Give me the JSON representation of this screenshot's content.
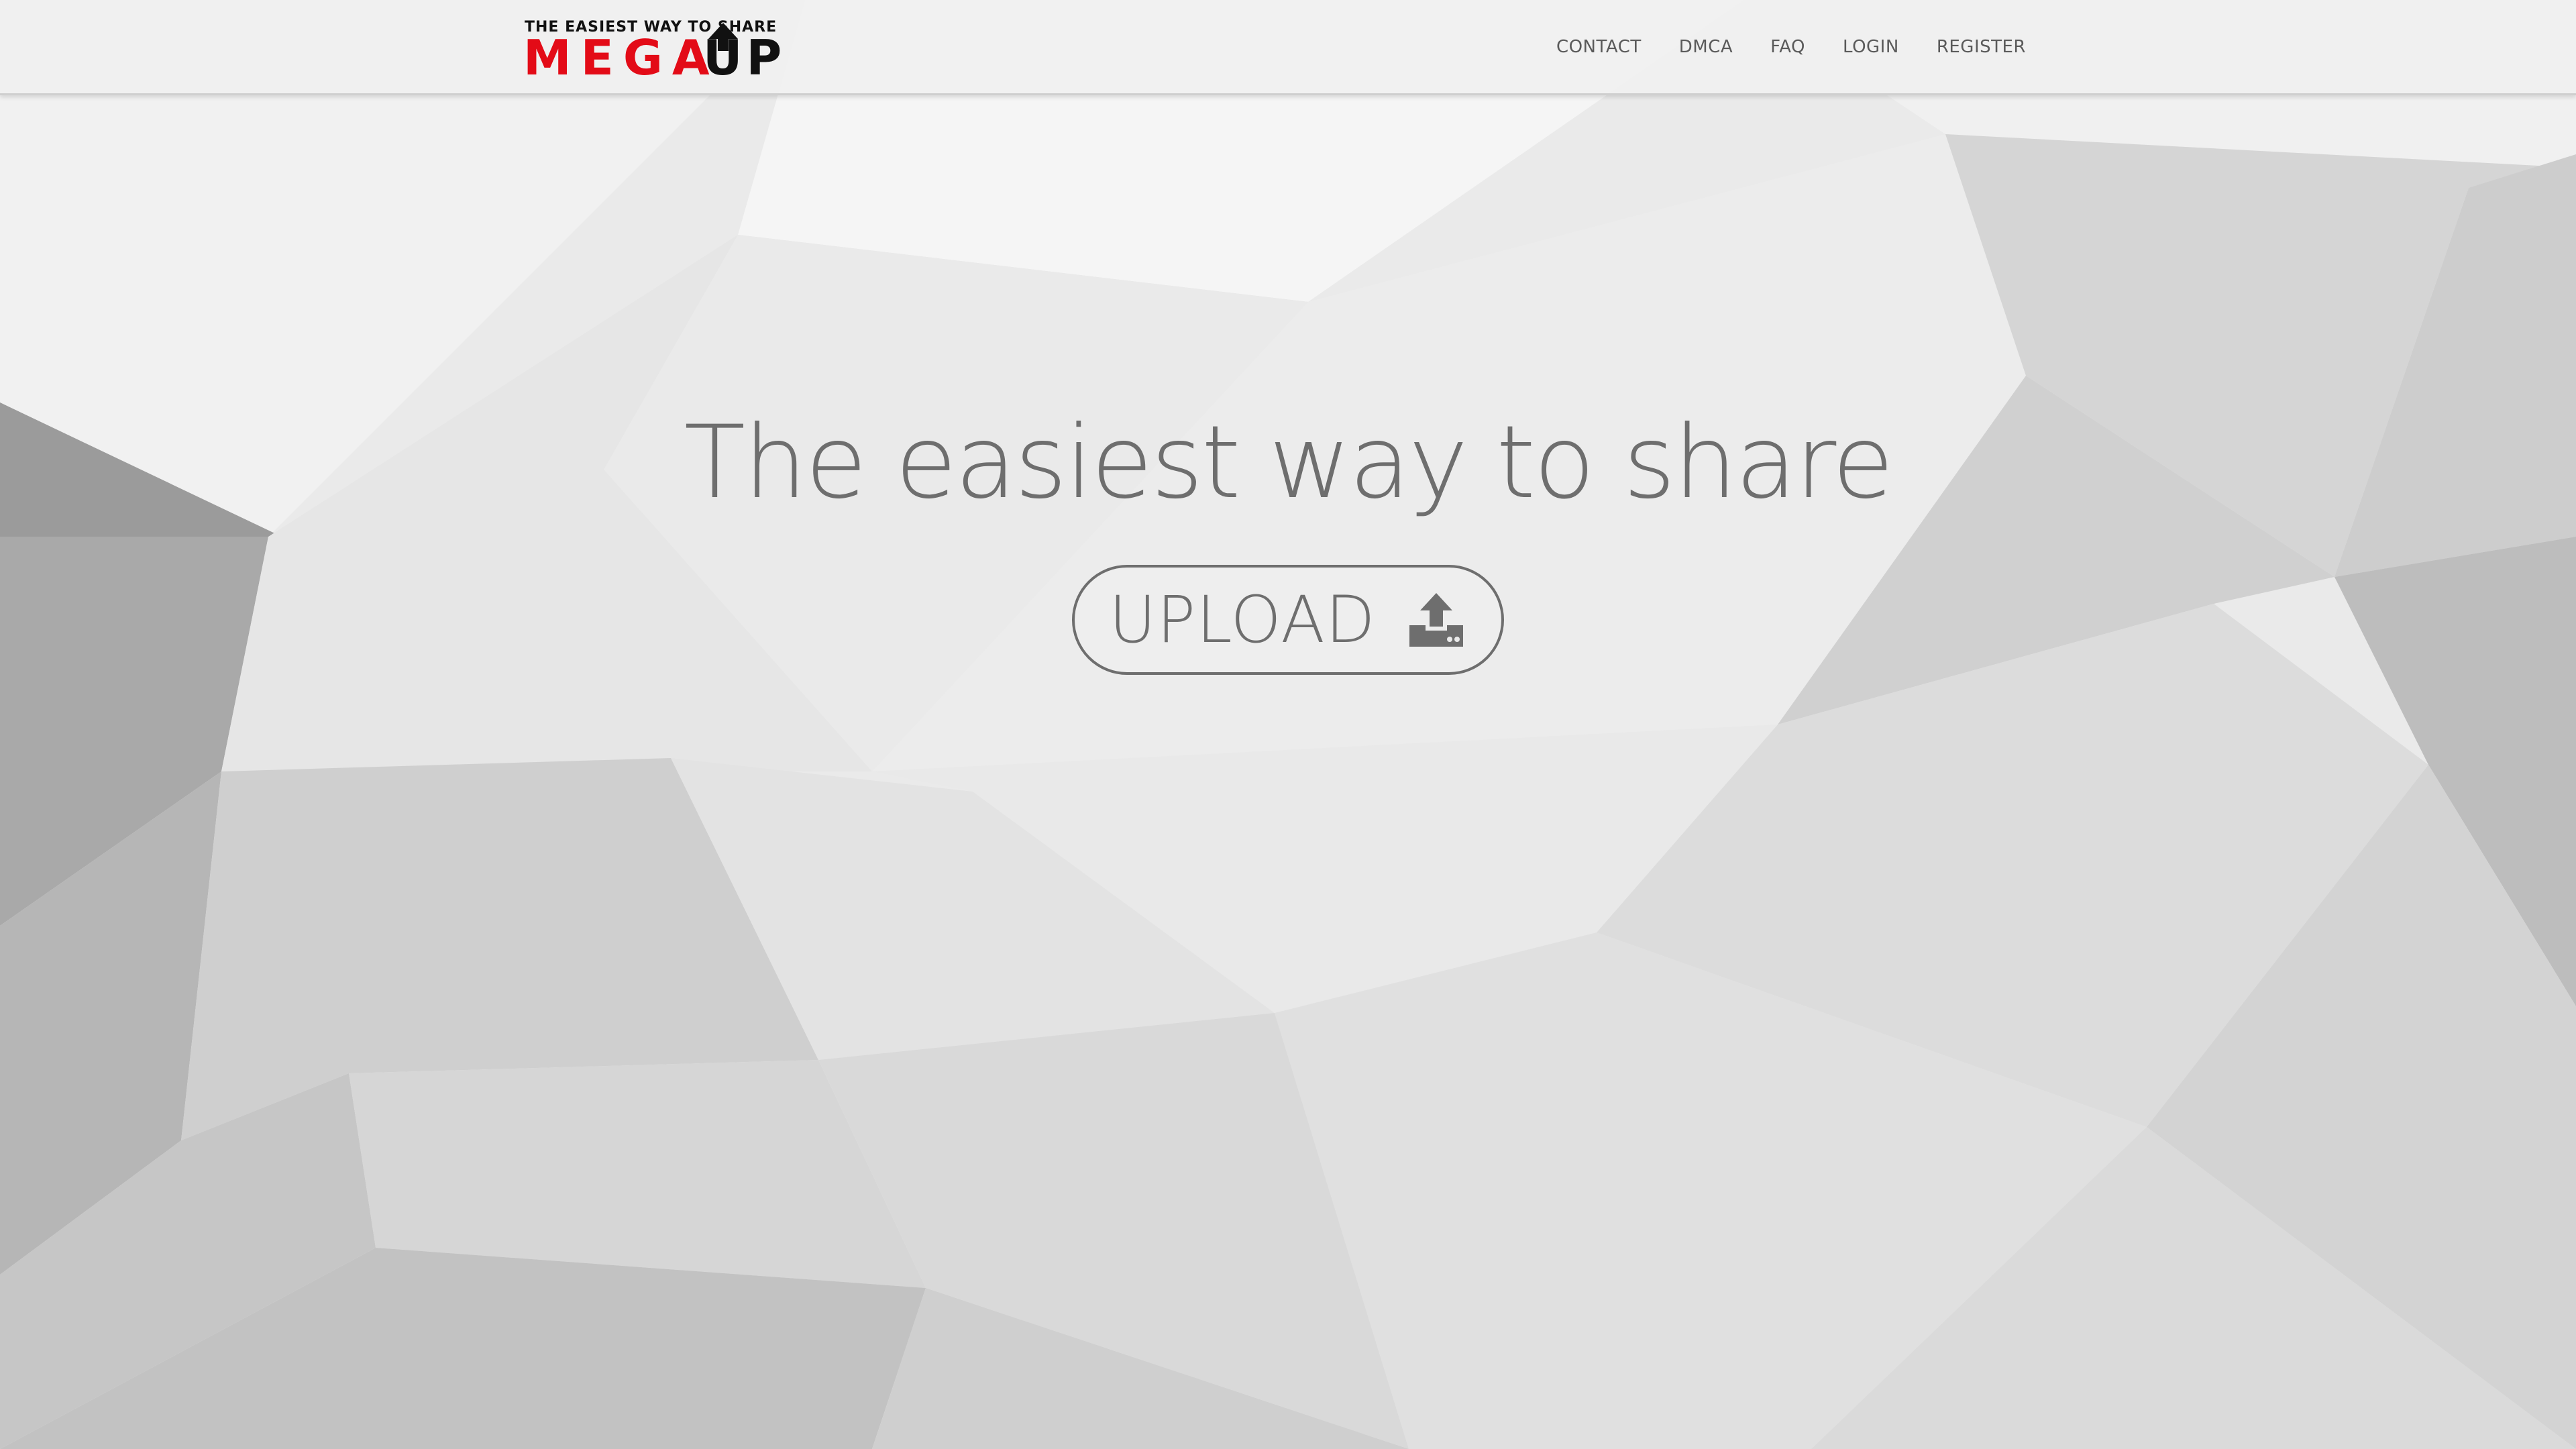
{
  "logo": {
    "tagline": "THE EASIEST WAY TO SHARE",
    "mega": "MEGA",
    "up": "UP"
  },
  "nav": {
    "items": [
      {
        "label": "CONTACT"
      },
      {
        "label": "DMCA"
      },
      {
        "label": "FAQ"
      },
      {
        "label": "LOGIN"
      },
      {
        "label": "REGISTER"
      }
    ]
  },
  "hero": {
    "headline": "The easiest way to share",
    "upload_label": "UPLOAD",
    "upload_icon": "upload-icon"
  },
  "colors": {
    "accent_red": "#e30b17",
    "text_gray": "#6e6e6e",
    "nav_text": "#5a5a5a"
  }
}
